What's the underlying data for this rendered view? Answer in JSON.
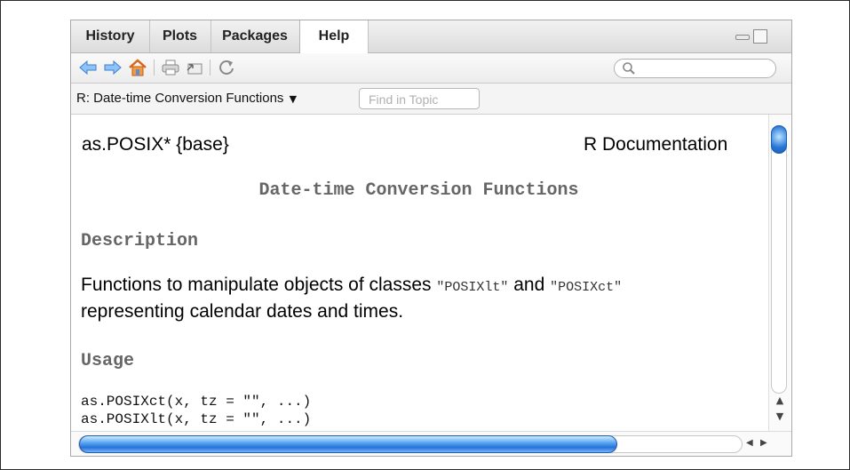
{
  "tabs": [
    {
      "label": "History",
      "active": false
    },
    {
      "label": "Plots",
      "active": false
    },
    {
      "label": "Packages",
      "active": false
    },
    {
      "label": "Help",
      "active": true
    }
  ],
  "toolbar": {
    "icons": [
      "back-arrow-icon",
      "forward-arrow-icon",
      "home-icon",
      "print-icon",
      "open-in-window-icon",
      "refresh-icon"
    ],
    "search_placeholder": ""
  },
  "topic_bar": {
    "topic_title": "R: Date-time Conversion Functions",
    "dropdown_glyph": "▼",
    "find_placeholder": "Find in Topic"
  },
  "doc": {
    "name": "as.POSIX* {base}",
    "source": "R Documentation",
    "title": "Date-time Conversion Functions",
    "description_heading": "Description",
    "description_pre": "Functions to manipulate objects of classes ",
    "description_code1": "\"POSIXlt\"",
    "description_and": " and ",
    "description_code2": "\"POSIXct\"",
    "description_post": "representing calendar dates and times.",
    "usage_heading": "Usage",
    "usage_lines": [
      "as.POSIXct(x, tz = \"\", ...)",
      "as.POSIXlt(x, tz = \"\", ...)"
    ]
  },
  "colors": {
    "accent_scroll": "#2a79d8",
    "heading_gray": "#666666",
    "nav_arrow_blue": "#4a90e2",
    "home_orange": "#e07a1f"
  }
}
